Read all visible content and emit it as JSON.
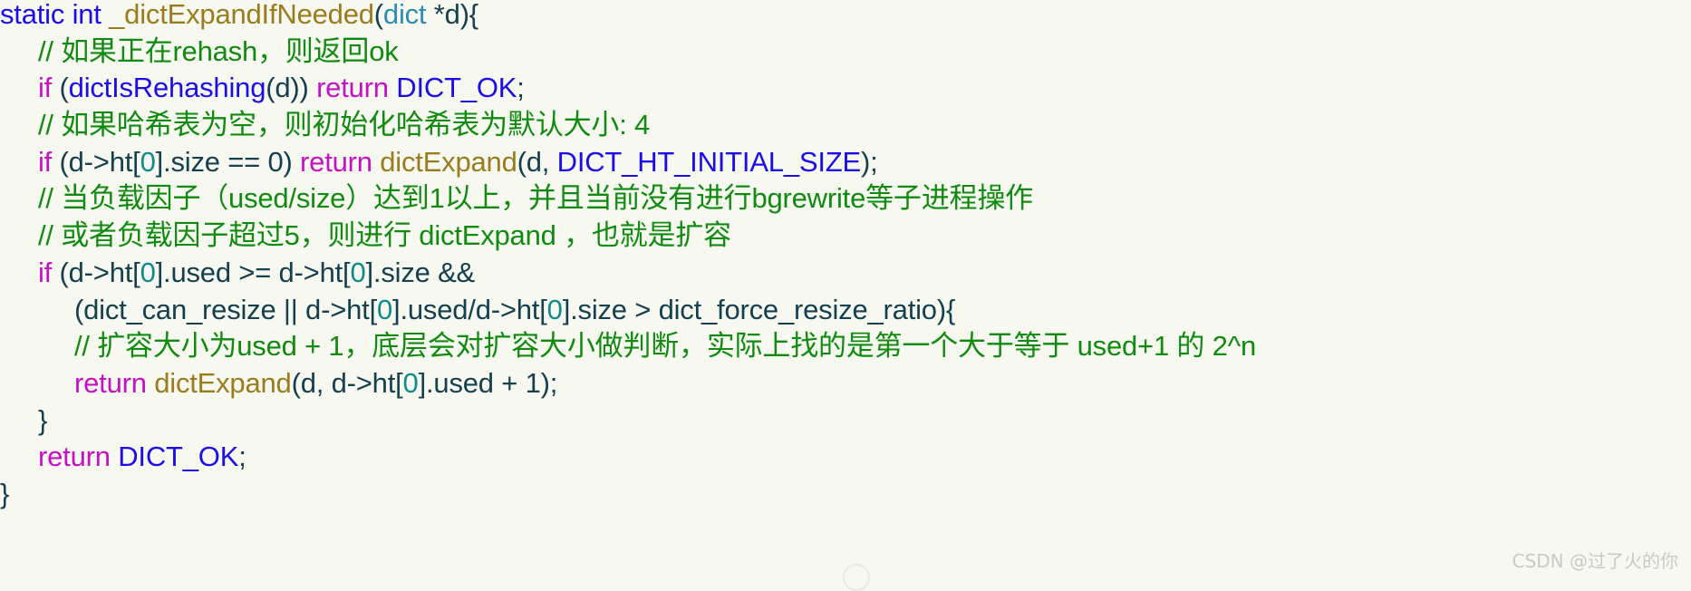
{
  "editor": {
    "background_color": "#f7f9f0",
    "language": "c",
    "watermark": "CSDN @过了火的你"
  },
  "palette": {
    "keyword": "#1b0ce8",
    "function": "#9a7c1e",
    "type": "#2e8cb4",
    "control": "#c511c5",
    "comment": "#108a10",
    "plain": "#15404f",
    "number": "#108a8a"
  },
  "code": {
    "lines": [
      {
        "id": "line-1",
        "indent": 0,
        "tokens": [
          {
            "text": "static int",
            "cls": "t-kw"
          },
          {
            "text": " ",
            "cls": "t-plain"
          },
          {
            "text": "_dictExpandIfNeeded",
            "cls": "t-fn"
          },
          {
            "text": "(",
            "cls": "t-punct"
          },
          {
            "text": "dict",
            "cls": "t-type"
          },
          {
            "text": " *d",
            "cls": "t-plain"
          },
          {
            "text": "){",
            "cls": "t-punct"
          }
        ]
      },
      {
        "id": "line-2",
        "indent": 1,
        "tokens": [
          {
            "text": "// 如果正在rehash，则返回ok",
            "cls": "t-com"
          }
        ]
      },
      {
        "id": "line-3",
        "indent": 1,
        "tokens": [
          {
            "text": "if",
            "cls": "t-ctrl"
          },
          {
            "text": " (",
            "cls": "t-punct"
          },
          {
            "text": "dictIsRehashing",
            "cls": "t-kw"
          },
          {
            "text": "(d)) ",
            "cls": "t-plain"
          },
          {
            "text": "return",
            "cls": "t-ctrl"
          },
          {
            "text": " ",
            "cls": "t-plain"
          },
          {
            "text": "DICT_OK",
            "cls": "t-const"
          },
          {
            "text": ";",
            "cls": "t-punct"
          }
        ]
      },
      {
        "id": "line-4",
        "indent": 1,
        "tokens": [
          {
            "text": "// 如果哈希表为空，则初始化哈希表为默认大小: 4",
            "cls": "t-com"
          }
        ]
      },
      {
        "id": "line-5",
        "indent": 1,
        "tokens": [
          {
            "text": "if",
            "cls": "t-ctrl"
          },
          {
            "text": " (d->ht[",
            "cls": "t-plain"
          },
          {
            "text": "0",
            "cls": "t-num"
          },
          {
            "text": "].size == ",
            "cls": "t-plain"
          },
          {
            "text": "0",
            "cls": "t-plain"
          },
          {
            "text": ") ",
            "cls": "t-plain"
          },
          {
            "text": "return",
            "cls": "t-ctrl"
          },
          {
            "text": " ",
            "cls": "t-plain"
          },
          {
            "text": "dictExpand",
            "cls": "t-fn"
          },
          {
            "text": "(d, ",
            "cls": "t-plain"
          },
          {
            "text": "DICT_HT_INITIAL_SIZE",
            "cls": "t-const"
          },
          {
            "text": ");",
            "cls": "t-punct"
          }
        ]
      },
      {
        "id": "line-6",
        "indent": 1,
        "tokens": [
          {
            "text": "// 当负载因子（used/size）达到1以上，并且当前没有进行bgrewrite等子进程操作",
            "cls": "t-com"
          }
        ]
      },
      {
        "id": "line-7",
        "indent": 1,
        "tokens": [
          {
            "text": "// 或者负载因子超过5，则进行 dictExpand ，也就是扩容",
            "cls": "t-com"
          }
        ]
      },
      {
        "id": "line-8",
        "indent": 1,
        "tokens": [
          {
            "text": "if",
            "cls": "t-ctrl"
          },
          {
            "text": " (d->ht[",
            "cls": "t-plain"
          },
          {
            "text": "0",
            "cls": "t-num"
          },
          {
            "text": "].used >= d->ht[",
            "cls": "t-plain"
          },
          {
            "text": "0",
            "cls": "t-num"
          },
          {
            "text": "].size &&",
            "cls": "t-plain"
          }
        ]
      },
      {
        "id": "line-9",
        "indent": 2,
        "tokens": [
          {
            "text": "(dict_can_resize || d->ht[",
            "cls": "t-plain"
          },
          {
            "text": "0",
            "cls": "t-num"
          },
          {
            "text": "].used/d->ht[",
            "cls": "t-plain"
          },
          {
            "text": "0",
            "cls": "t-num"
          },
          {
            "text": "].size > dict_force_resize_ratio){",
            "cls": "t-plain"
          }
        ]
      },
      {
        "id": "line-10",
        "indent": 2,
        "tokens": [
          {
            "text": "// 扩容大小为used + 1，底层会对扩容大小做判断，实际上找的是第一个大于等于 used+1 的 2^n",
            "cls": "t-com"
          }
        ]
      },
      {
        "id": "line-11",
        "indent": 2,
        "tokens": [
          {
            "text": "return",
            "cls": "t-ctrl"
          },
          {
            "text": " ",
            "cls": "t-plain"
          },
          {
            "text": "dictExpand",
            "cls": "t-fn"
          },
          {
            "text": "(d, d->ht[",
            "cls": "t-plain"
          },
          {
            "text": "0",
            "cls": "t-num"
          },
          {
            "text": "].used + ",
            "cls": "t-plain"
          },
          {
            "text": "1",
            "cls": "t-plain"
          },
          {
            "text": ");",
            "cls": "t-punct"
          }
        ]
      },
      {
        "id": "line-12",
        "indent": 1,
        "tokens": [
          {
            "text": "}",
            "cls": "t-punct"
          }
        ]
      },
      {
        "id": "line-13",
        "indent": 1,
        "tokens": [
          {
            "text": "return",
            "cls": "t-ctrl"
          },
          {
            "text": " ",
            "cls": "t-plain"
          },
          {
            "text": "DICT_OK",
            "cls": "t-const"
          },
          {
            "text": ";",
            "cls": "t-punct"
          }
        ]
      },
      {
        "id": "line-14",
        "indent": 0,
        "tokens": [
          {
            "text": "}",
            "cls": "t-punct"
          }
        ]
      }
    ]
  }
}
